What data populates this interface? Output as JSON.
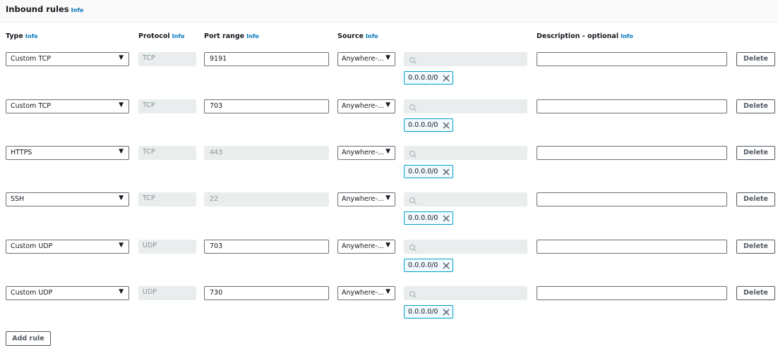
{
  "header": {
    "title": "Inbound rules",
    "info": "Info"
  },
  "columns": {
    "type": "Type",
    "protocol": "Protocol",
    "port_range": "Port range",
    "source": "Source",
    "description": "Description - optional",
    "info": "Info"
  },
  "rules": [
    {
      "type": "Custom TCP",
      "protocol": "TCP",
      "port_range": "9191",
      "port_editable": true,
      "source": "Anywhere-...",
      "cidr": "0.0.0.0/0",
      "description": "",
      "delete_label": "Delete"
    },
    {
      "type": "Custom TCP",
      "protocol": "TCP",
      "port_range": "703",
      "port_editable": true,
      "source": "Anywhere-...",
      "cidr": "0.0.0.0/0",
      "description": "",
      "delete_label": "Delete"
    },
    {
      "type": "HTTPS",
      "protocol": "TCP",
      "port_range": "443",
      "port_editable": false,
      "source": "Anywhere-...",
      "cidr": "0.0.0.0/0",
      "description": "",
      "delete_label": "Delete"
    },
    {
      "type": "SSH",
      "protocol": "TCP",
      "port_range": "22",
      "port_editable": false,
      "source": "Anywhere-...",
      "cidr": "0.0.0.0/0",
      "description": "",
      "delete_label": "Delete"
    },
    {
      "type": "Custom UDP",
      "protocol": "UDP",
      "port_range": "703",
      "port_editable": true,
      "source": "Anywhere-...",
      "cidr": "0.0.0.0/0",
      "description": "",
      "delete_label": "Delete"
    },
    {
      "type": "Custom UDP",
      "protocol": "UDP",
      "port_range": "730",
      "port_editable": true,
      "source": "Anywhere-...",
      "cidr": "0.0.0.0/0",
      "description": "",
      "delete_label": "Delete"
    }
  ],
  "add_rule_label": "Add rule",
  "icons": {
    "select_caret": "caret-down-icon",
    "search": "search-icon",
    "token_remove": "close-icon"
  },
  "colors": {
    "info_link": "#0073bb",
    "token_border": "#00a1c9",
    "disabled_bg": "#eaeded"
  }
}
